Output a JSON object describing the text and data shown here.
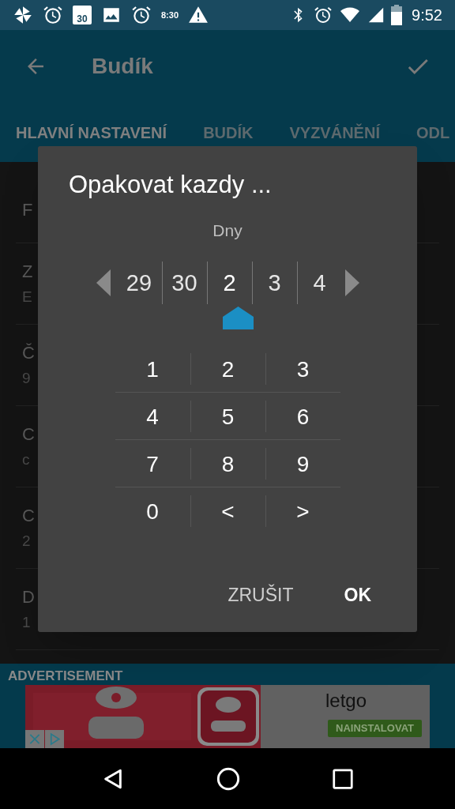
{
  "status_bar": {
    "calendar_day": "30",
    "widget_time": "8:30",
    "time": "9:52"
  },
  "toolbar": {
    "title": "Budík"
  },
  "tabs": [
    {
      "label": "HLAVNÍ NASTAVENÍ",
      "selected": true
    },
    {
      "label": "BUDÍK",
      "selected": false
    },
    {
      "label": "VYZVÁNĚNÍ",
      "selected": false
    },
    {
      "label": "ODL",
      "selected": false
    }
  ],
  "background_rows": [
    {
      "title": "F"
    },
    {
      "title": "Z",
      "subtitle": "E"
    },
    {
      "title": "Č",
      "subtitle": "9"
    },
    {
      "title": "C",
      "subtitle": "c"
    },
    {
      "title": "C",
      "subtitle": "2"
    },
    {
      "title": "D",
      "subtitle": "1"
    }
  ],
  "dialog": {
    "title": "Opakovat kazdy ...",
    "unit": "Dny",
    "picker": [
      {
        "value": "29",
        "selected": false
      },
      {
        "value": "30",
        "selected": false
      },
      {
        "value": "2",
        "selected": true
      },
      {
        "value": "3",
        "selected": false
      },
      {
        "value": "4",
        "selected": false
      }
    ],
    "keypad": [
      "1",
      "2",
      "3",
      "4",
      "5",
      "6",
      "7",
      "8",
      "9",
      "0",
      "<",
      ">"
    ],
    "buttons": [
      {
        "label": "ZRUŠIT",
        "kind": "cancel"
      },
      {
        "label": "OK",
        "kind": "confirm"
      }
    ]
  },
  "ad": {
    "label": "ADVERTISEMENT",
    "app_name": "letgo",
    "install": "NAINSTALOVAT"
  }
}
